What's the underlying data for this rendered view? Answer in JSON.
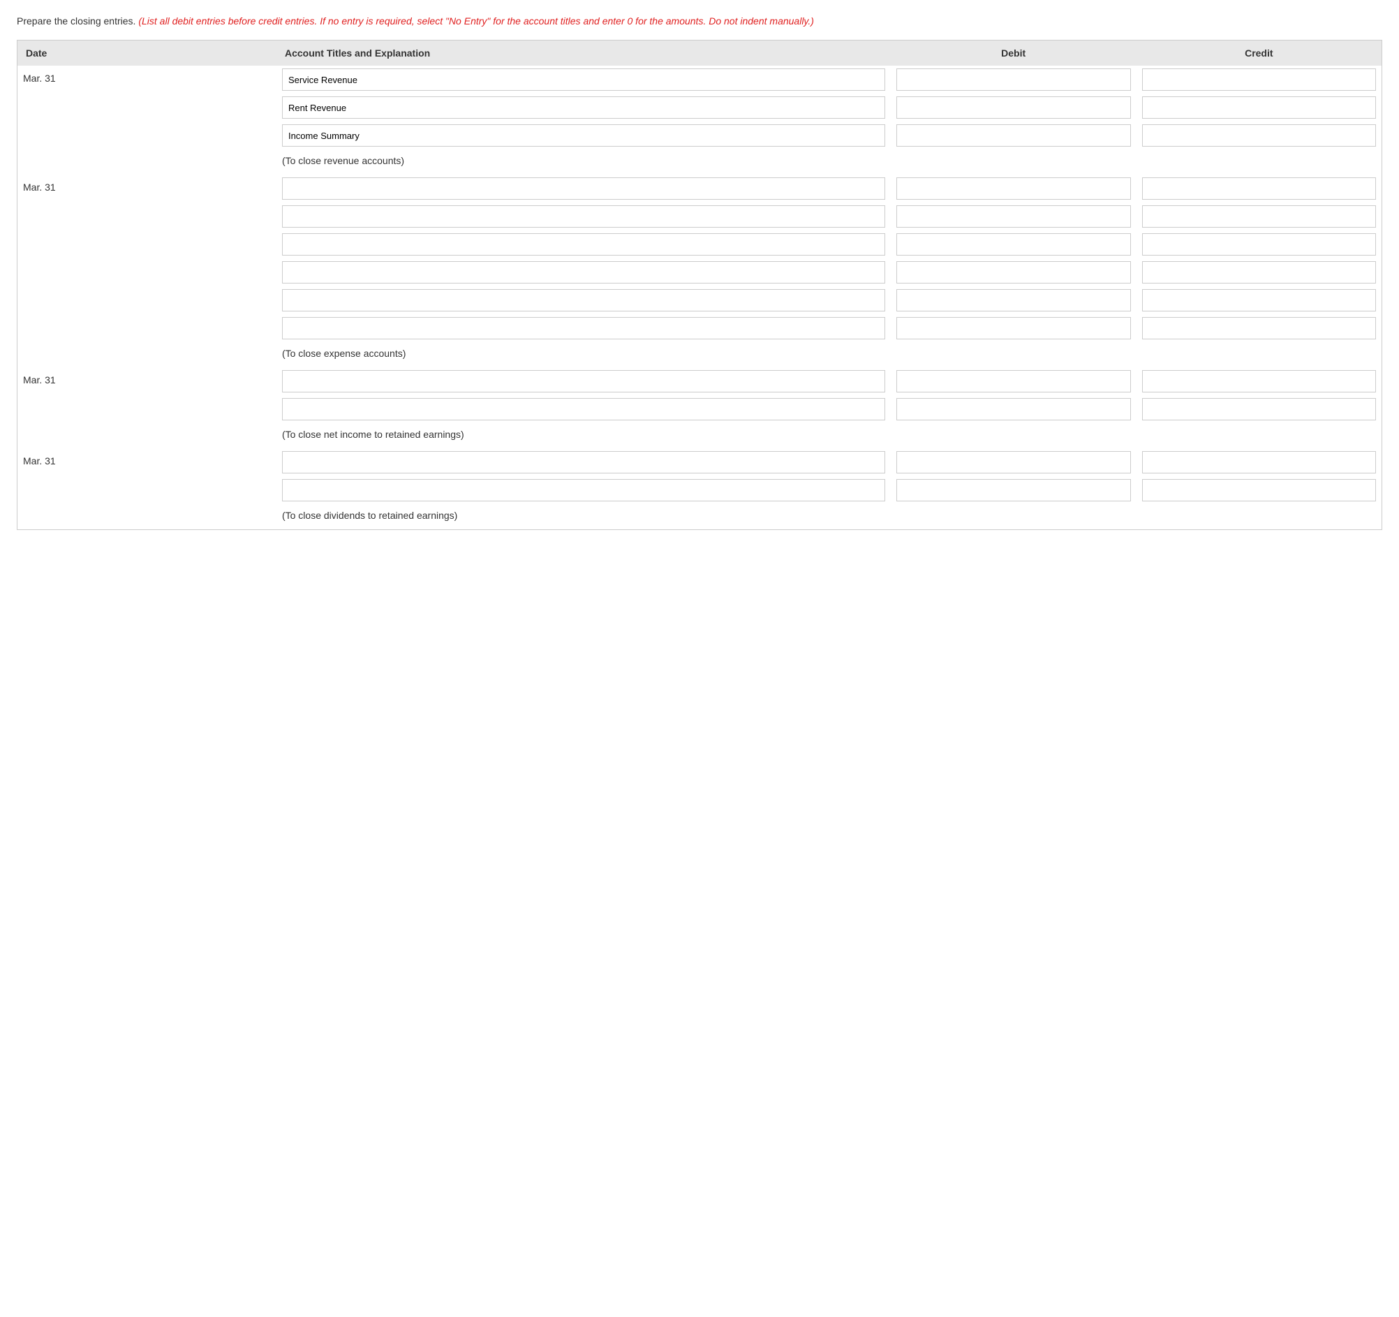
{
  "intro": {
    "prefix": "Prepare the closing entries.",
    "italic_text": "(List all debit entries before credit entries. If no entry is required, select \"No Entry\" for the account titles and enter 0 for the amounts. Do not indent manually.)"
  },
  "table": {
    "headers": {
      "date": "Date",
      "account": "Account Titles and Explanation",
      "debit": "Debit",
      "credit": "Credit"
    },
    "sections": [
      {
        "id": "section1",
        "date": "Mar. 31",
        "rows": [
          {
            "account_value": "Service Revenue",
            "debit_value": "",
            "credit_value": ""
          },
          {
            "account_value": "Rent Revenue",
            "debit_value": "",
            "credit_value": ""
          },
          {
            "account_value": "Income Summary",
            "debit_value": "",
            "credit_value": ""
          }
        ],
        "note": "(To close revenue accounts)"
      },
      {
        "id": "section2",
        "date": "Mar. 31",
        "rows": [
          {
            "account_value": "",
            "debit_value": "",
            "credit_value": ""
          },
          {
            "account_value": "",
            "debit_value": "",
            "credit_value": ""
          },
          {
            "account_value": "",
            "debit_value": "",
            "credit_value": ""
          },
          {
            "account_value": "",
            "debit_value": "",
            "credit_value": ""
          },
          {
            "account_value": "",
            "debit_value": "",
            "credit_value": ""
          },
          {
            "account_value": "",
            "debit_value": "",
            "credit_value": ""
          }
        ],
        "note": "(To close expense accounts)"
      },
      {
        "id": "section3",
        "date": "Mar. 31",
        "rows": [
          {
            "account_value": "",
            "debit_value": "",
            "credit_value": ""
          },
          {
            "account_value": "",
            "debit_value": "",
            "credit_value": ""
          }
        ],
        "note": "(To close net income to retained earnings)"
      },
      {
        "id": "section4",
        "date": "Mar. 31",
        "rows": [
          {
            "account_value": "",
            "debit_value": "",
            "credit_value": ""
          },
          {
            "account_value": "",
            "debit_value": "",
            "credit_value": ""
          }
        ],
        "note": "(To close dividends to retained earnings)"
      }
    ]
  }
}
